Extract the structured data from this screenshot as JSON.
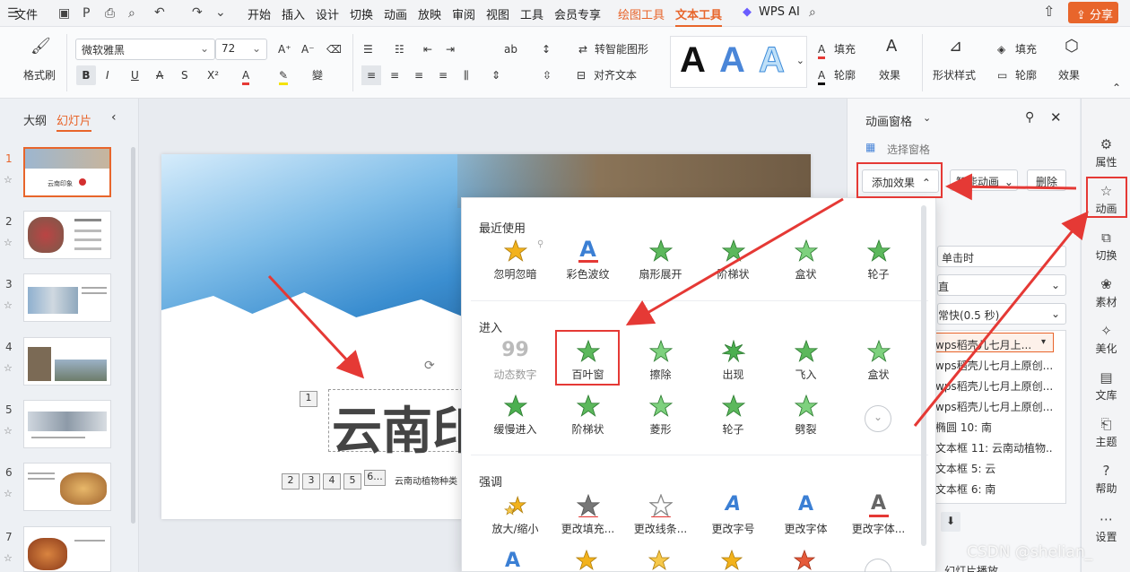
{
  "menu": {
    "file": "文件",
    "items": [
      "开始",
      "插入",
      "设计",
      "切换",
      "动画",
      "放映",
      "审阅",
      "视图",
      "工具",
      "会员专享"
    ],
    "draw_tools": "绘图工具",
    "text_tools": "文本工具",
    "wps_ai": "WPS AI",
    "share": "分享"
  },
  "ribbon": {
    "format_painter": "格式刷",
    "font": "微软雅黑",
    "size": "72",
    "smart_graphic": "转智能图形",
    "align_text": "对齐文本",
    "fill": "填充",
    "outline": "轮廓",
    "effect": "效果",
    "shape_style": "形状样式",
    "fill2": "填充",
    "outline2": "轮廓",
    "effect2": "效果",
    "big_a": "A"
  },
  "left": {
    "tab_outline": "大纲",
    "tab_slides": "幻灯片",
    "slides": [
      "1",
      "2",
      "3",
      "4",
      "5",
      "6",
      "7"
    ],
    "thumb1_title": "云南印象"
  },
  "slide": {
    "title": "云南印",
    "subtitle": "云南动植物种类",
    "badges": [
      "1",
      "2",
      "3",
      "4",
      "5",
      "6..."
    ]
  },
  "anim_panel": {
    "title": "动画窗格",
    "select_pane": "选择窗格",
    "add_effect": "添加效果",
    "smart_anim": "智能动画",
    "delete": "删除",
    "start": "单击时",
    "direction": "直",
    "speed": "常快(0.5 秒)",
    "list": [
      "wps稻壳儿七月上...",
      "wps稻壳儿七月上原创...",
      "wps稻壳儿七月上原创...",
      "wps稻壳儿七月上原创...",
      "椭圆 10: 南",
      "文本框 11: 云南动植物...",
      "文本框 5: 云",
      "文本框 6: 南"
    ],
    "slideshow": "幻灯片播放"
  },
  "sidebar": [
    "属性",
    "动画",
    "切换",
    "素材",
    "美化",
    "文库",
    "主题",
    "帮助",
    "设置"
  ],
  "dropdown": {
    "recent_title": "最近使用",
    "recent": [
      "忽明忽暗",
      "彩色波纹",
      "扇形展开",
      "阶梯状",
      "盒状",
      "轮子"
    ],
    "enter_title": "进入",
    "enter": [
      "动态数字",
      "百叶窗",
      "擦除",
      "出现",
      "飞入",
      "盒状",
      "缓慢进入",
      "阶梯状",
      "菱形",
      "轮子",
      "劈裂"
    ],
    "emph_title": "强调",
    "emph": [
      "放大/缩小",
      "更改填充...",
      "更改线条...",
      "更改字号",
      "更改字体",
      "更改字体..."
    ]
  },
  "watermark": "CSDN @shelian_",
  "colors": {
    "accent": "#e8652b",
    "red_box": "#e53935",
    "green_star": "#4caf50"
  }
}
